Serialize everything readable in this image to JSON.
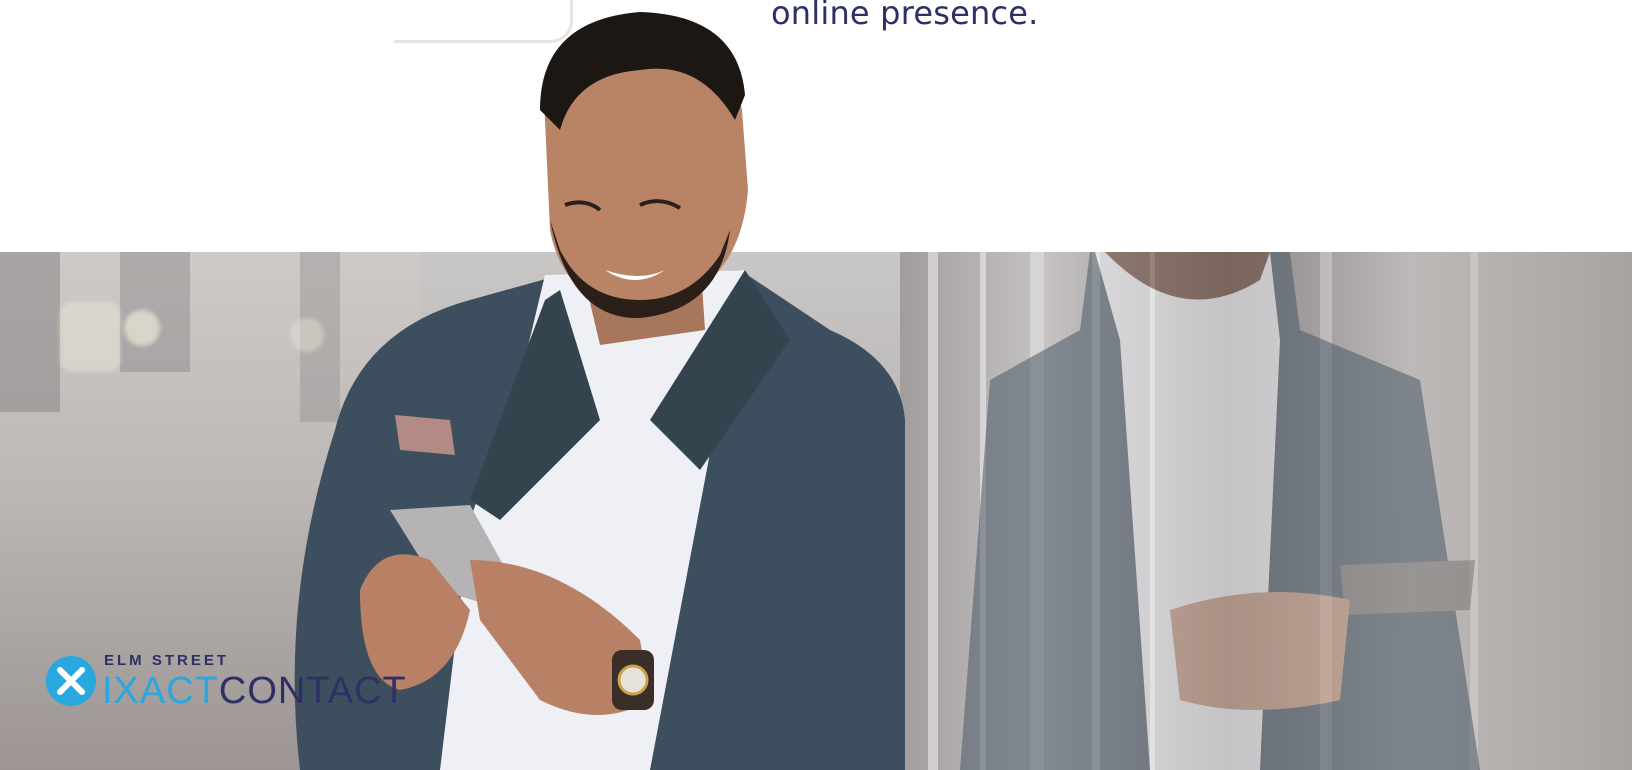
{
  "intro": {
    "tagline": "online presence."
  },
  "brand": {
    "name_small": "ELM STREET",
    "name_part1": "IXACT",
    "name_part2": "CONTACT",
    "accent_color": "#28a8de",
    "dark_color": "#2e3063"
  },
  "hero": {
    "image_subject": "smiling businessman in a grey blazer looking at a smartphone beside his reflection in a glass wall"
  }
}
